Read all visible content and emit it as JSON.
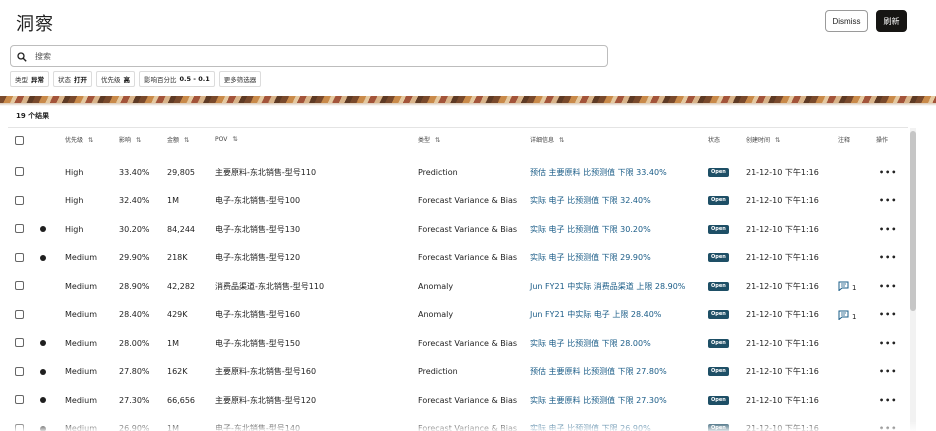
{
  "page": {
    "title": "洞察",
    "dismiss_label": "Dismiss",
    "refresh_label": "刷新"
  },
  "search": {
    "placeholder": "搜索",
    "value": ""
  },
  "filters": [
    {
      "label": "类型",
      "value": "异常"
    },
    {
      "label": "状态",
      "value": "打开"
    },
    {
      "label": "优先级",
      "value": "高"
    },
    {
      "label": "影响百分比",
      "value": "0.5 - 0.1"
    },
    {
      "label": "更多筛选器",
      "value": ""
    }
  ],
  "results_count": "19 个结果",
  "columns": {
    "priority": "优先级",
    "impact": "影响",
    "amount": "金额",
    "pov": "POV",
    "type": "类型",
    "details": "详细信息",
    "status": "状态",
    "created": "创建时间",
    "notes": "注释",
    "actions": "操作"
  },
  "rows": [
    {
      "dot": false,
      "priority": "High",
      "impact": "33.40%",
      "amount": "29,805",
      "pov": "主要原料-东北销售-型号110",
      "type": "Prediction",
      "details": "预估 主要原料 比预测值 下限 33.40%",
      "status": "Open",
      "created": "21-12-10 下午1:16",
      "comments": ""
    },
    {
      "dot": false,
      "priority": "High",
      "impact": "32.40%",
      "amount": "1M",
      "pov": "电子-东北销售-型号100",
      "type": "Forecast Variance & Bias",
      "details": "实际 电子 比预测值 下限 32.40%",
      "status": "Open",
      "created": "21-12-10 下午1:16",
      "comments": ""
    },
    {
      "dot": true,
      "priority": "High",
      "impact": "30.20%",
      "amount": "84,244",
      "pov": "电子-东北销售-型号130",
      "type": "Forecast Variance & Bias",
      "details": "实际 电子 比预测值 下限 30.20%",
      "status": "Open",
      "created": "21-12-10 下午1:16",
      "comments": ""
    },
    {
      "dot": true,
      "priority": "Medium",
      "impact": "29.90%",
      "amount": "218K",
      "pov": "电子-东北销售-型号120",
      "type": "Forecast Variance & Bias",
      "details": "实际 电子 比预测值 下限 29.90%",
      "status": "Open",
      "created": "21-12-10 下午1:16",
      "comments": ""
    },
    {
      "dot": false,
      "priority": "Medium",
      "impact": "28.90%",
      "amount": "42,282",
      "pov": "消费品渠道-东北销售-型号110",
      "type": "Anomaly",
      "details": "Jun FY21 中实际 消费品渠道 上限 28.90%",
      "status": "Open",
      "created": "21-12-10 下午1:16",
      "comments": "1"
    },
    {
      "dot": false,
      "priority": "Medium",
      "impact": "28.40%",
      "amount": "429K",
      "pov": "电子-东北销售-型号160",
      "type": "Anomaly",
      "details": "Jun FY21 中实际 电子 上限 28.40%",
      "status": "Open",
      "created": "21-12-10 下午1:16",
      "comments": "1"
    },
    {
      "dot": true,
      "priority": "Medium",
      "impact": "28.00%",
      "amount": "1M",
      "pov": "电子-东北销售-型号150",
      "type": "Forecast Variance & Bias",
      "details": "实际 电子 比预测值 下限 28.00%",
      "status": "Open",
      "created": "21-12-10 下午1:16",
      "comments": ""
    },
    {
      "dot": true,
      "priority": "Medium",
      "impact": "27.80%",
      "amount": "162K",
      "pov": "主要原料-东北销售-型号160",
      "type": "Prediction",
      "details": "预估 主要原料 比预测值 下限 27.80%",
      "status": "Open",
      "created": "21-12-10 下午1:16",
      "comments": ""
    },
    {
      "dot": true,
      "priority": "Medium",
      "impact": "27.30%",
      "amount": "66,656",
      "pov": "主要原料-东北销售-型号120",
      "type": "Forecast Variance & Bias",
      "details": "实际 主要原料 比预测值 下限 27.30%",
      "status": "Open",
      "created": "21-12-10 下午1:16",
      "comments": ""
    },
    {
      "dot": true,
      "priority": "Medium",
      "impact": "26.90%",
      "amount": "1M",
      "pov": "电子-东北销售-型号140",
      "type": "Forecast Variance & Bias",
      "details": "实际 电子 比预测值 下限 26.90%",
      "status": "Open",
      "created": "21-12-10 下午1:16",
      "comments": ""
    }
  ],
  "colors": {
    "link": "#1a5c87",
    "status_badge": "#1e4f66",
    "primary_button": "#161513"
  }
}
